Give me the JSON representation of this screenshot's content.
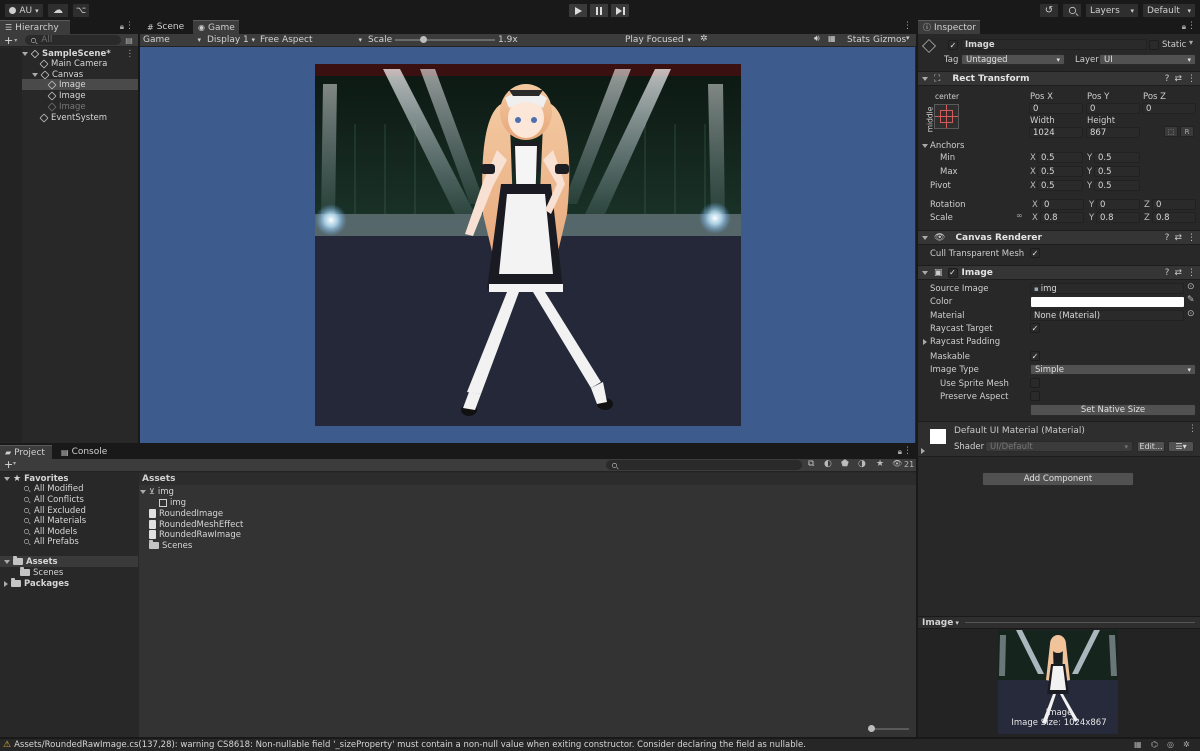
{
  "toolbar": {
    "account": "AU",
    "layers": "Layers",
    "layout": "Default"
  },
  "hierarchy": {
    "tab": "Hierarchy",
    "search_placeholder": "All",
    "items": [
      {
        "label": "SampleScene*"
      },
      {
        "label": "Main Camera"
      },
      {
        "label": "Canvas"
      },
      {
        "label": "Image"
      },
      {
        "label": "Image"
      },
      {
        "label": "Image"
      },
      {
        "label": "EventSystem"
      }
    ]
  },
  "scene_tabs": {
    "scene": "Scene",
    "game": "Game"
  },
  "game_bar": {
    "mode": "Game",
    "display": "Display 1",
    "aspect": "Free Aspect",
    "scale_label": "Scale",
    "scale_value": "1.9x",
    "play_focused": "Play Focused",
    "stats": "Stats",
    "gizmos": "Gizmos"
  },
  "inspector": {
    "tab": "Inspector",
    "object_name": "Image",
    "static_label": "Static",
    "tag_label": "Tag",
    "tag_value": "Untagged",
    "layer_label": "Layer",
    "layer_value": "UI",
    "rect_transform": {
      "title": "Rect Transform",
      "anchor_preset_top": "center",
      "anchor_preset_side": "middle",
      "pos_x_label": "Pos X",
      "pos_x": "0",
      "pos_y_label": "Pos Y",
      "pos_y": "0",
      "pos_z_label": "Pos Z",
      "pos_z": "0",
      "width_label": "Width",
      "width": "1024",
      "height_label": "Height",
      "height": "867",
      "r_button": "R",
      "anchors_label": "Anchors",
      "min_label": "Min",
      "min_x": "0.5",
      "min_y": "0.5",
      "max_label": "Max",
      "max_x": "0.5",
      "max_y": "0.5",
      "pivot_label": "Pivot",
      "pivot_x": "0.5",
      "pivot_y": "0.5",
      "rotation_label": "Rotation",
      "rot_x": "0",
      "rot_y": "0",
      "rot_z": "0",
      "scale_label": "Scale",
      "scale_x": "0.8",
      "scale_y": "0.8",
      "scale_z": "0.8",
      "x": "X",
      "y": "Y",
      "z": "Z"
    },
    "canvas_renderer": {
      "title": "Canvas Renderer",
      "cull_label": "Cull Transparent Mesh"
    },
    "image": {
      "title": "Image",
      "source_label": "Source Image",
      "source_value": "img",
      "color_label": "Color",
      "material_label": "Material",
      "material_value": "None (Material)",
      "raycast_target_label": "Raycast Target",
      "raycast_padding_label": "Raycast Padding",
      "maskable_label": "Maskable",
      "image_type_label": "Image Type",
      "image_type_value": "Simple",
      "use_sprite_mesh_label": "Use Sprite Mesh",
      "preserve_aspect_label": "Preserve Aspect",
      "native_size_button": "Set Native Size"
    },
    "material": {
      "title": "Default UI Material (Material)",
      "shader_label": "Shader",
      "shader_value": "UI/Default",
      "edit_button": "Edit..."
    },
    "add_component": "Add Component",
    "preview": {
      "title": "Image",
      "caption_name": "Image",
      "caption_size": "Image Size: 1024x867"
    }
  },
  "project": {
    "tab_project": "Project",
    "tab_console": "Console",
    "favorites_label": "Favorites",
    "favorites": [
      "All Modified",
      "All Conflicts",
      "All Excluded",
      "All Materials",
      "All Models",
      "All Prefabs"
    ],
    "assets_label": "Assets",
    "asset_folders": [
      "Scenes"
    ],
    "packages_label": "Packages",
    "breadcrumb": "Assets",
    "asset_count": "21",
    "files": [
      {
        "label": "img"
      },
      {
        "label": "img"
      },
      {
        "label": "RoundedImage"
      },
      {
        "label": "RoundedMeshEffect"
      },
      {
        "label": "RoundedRawImage"
      },
      {
        "label": "Scenes"
      }
    ]
  },
  "status": {
    "message": "Assets/RoundedRawImage.cs(137,28): warning CS8618: Non-nullable field '_sizeProperty' must contain a non-null value when exiting constructor. Consider declaring the field as nullable."
  },
  "colors": {
    "game_background": "#3e5b8e",
    "selection": "#4a4a4a",
    "warning": "#e2b33b"
  }
}
